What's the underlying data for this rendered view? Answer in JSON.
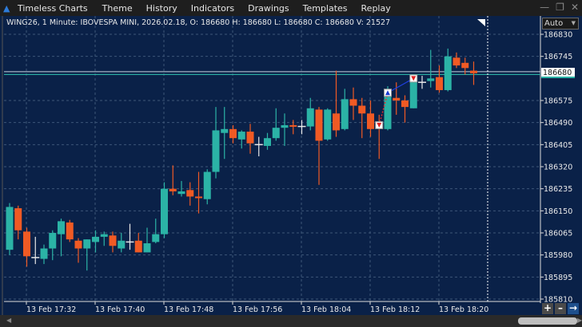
{
  "app": {
    "title": "Timeless Charts",
    "menu": [
      "Theme",
      "History",
      "Indicators",
      "Drawings",
      "Templates",
      "Replay"
    ]
  },
  "window_controls": [
    "minimize",
    "restore",
    "close"
  ],
  "info": "WING26, 1 Minute: IBOVESPA MINI, 2026.02.18, O: 186680 H: 186680 L: 186680 C: 186680 V: 21527",
  "scale_mode": "Auto",
  "current_price": "186680",
  "colors": {
    "up": "#2bb3a6",
    "down": "#f05a24",
    "background": "#0a2148",
    "doji": "#e8e8e8"
  },
  "chart_data": {
    "type": "candlestick",
    "y_ticks": [
      186830,
      186745,
      186575,
      186490,
      186405,
      186320,
      186235,
      186150,
      186065,
      185980,
      185895,
      185810
    ],
    "y_tick_labels": [
      "186830",
      "186745",
      "186575",
      "186490",
      "186405",
      "186320",
      "186235",
      "186150",
      "186065",
      "185980",
      "185895",
      "185810"
    ],
    "ylim": [
      185810,
      186830
    ],
    "x_tick_labels": [
      "13 Feb 17:32",
      "13 Feb 17:40",
      "13 Feb 17:48",
      "13 Feb 17:56",
      "13 Feb 18:04",
      "13 Feb 18:12",
      "13 Feb 18:20"
    ],
    "grid": true,
    "candles": [
      [
        186000,
        186180,
        185980,
        186165
      ],
      [
        186160,
        186170,
        186040,
        186075
      ],
      [
        186070,
        186085,
        185935,
        185975
      ],
      [
        185970,
        186050,
        185945,
        185970
      ],
      [
        185965,
        186020,
        185945,
        186005
      ],
      [
        186005,
        186075,
        185960,
        186065
      ],
      [
        186060,
        186120,
        185975,
        186110
      ],
      [
        186105,
        186115,
        186030,
        186040
      ],
      [
        186035,
        186045,
        185950,
        186005
      ],
      [
        186005,
        186040,
        185920,
        186040
      ],
      [
        186030,
        186075,
        185990,
        186050
      ],
      [
        186050,
        186070,
        186015,
        186060
      ],
      [
        186055,
        186070,
        185990,
        186015
      ],
      [
        186005,
        186065,
        185990,
        186035
      ],
      [
        186030,
        186100,
        186000,
        186030
      ],
      [
        186035,
        186065,
        185990,
        185990
      ],
      [
        185990,
        186085,
        185990,
        186025
      ],
      [
        186030,
        186120,
        186025,
        186060
      ],
      [
        186060,
        186260,
        186045,
        186235
      ],
      [
        186235,
        186325,
        186210,
        186225
      ],
      [
        186215,
        186265,
        186205,
        186225
      ],
      [
        186230,
        186260,
        186170,
        186205
      ],
      [
        186205,
        186300,
        186140,
        186200
      ],
      [
        186195,
        186310,
        186175,
        186300
      ],
      [
        186300,
        186550,
        186275,
        186460
      ],
      [
        186450,
        186550,
        186350,
        186465
      ],
      [
        186465,
        186480,
        186410,
        186430
      ],
      [
        186425,
        186460,
        186390,
        186455
      ],
      [
        186455,
        186485,
        186370,
        186410
      ],
      [
        186405,
        186435,
        186360,
        186405
      ],
      [
        186400,
        186450,
        186385,
        186430
      ],
      [
        186430,
        186545,
        186420,
        186470
      ],
      [
        186470,
        186525,
        186400,
        186480
      ],
      [
        186480,
        186500,
        186445,
        186475
      ],
      [
        186475,
        186500,
        186445,
        186475
      ],
      [
        186475,
        186585,
        186460,
        186545
      ],
      [
        186540,
        186550,
        186250,
        186420
      ],
      [
        186425,
        186545,
        186420,
        186540
      ],
      [
        186525,
        186690,
        186435,
        186460
      ],
      [
        186465,
        186620,
        186460,
        186580
      ],
      [
        186580,
        186625,
        186500,
        186555
      ],
      [
        186555,
        186585,
        186430,
        186525
      ],
      [
        186525,
        186575,
        186435,
        186465
      ],
      [
        186485,
        186520,
        186350,
        186470
      ],
      [
        186465,
        186630,
        186460,
        186620
      ],
      [
        186585,
        186645,
        186520,
        186575
      ],
      [
        186575,
        186595,
        186490,
        186550
      ],
      [
        186545,
        186665,
        186545,
        186660
      ],
      [
        186645,
        186670,
        186620,
        186645
      ],
      [
        186650,
        186770,
        186625,
        186660
      ],
      [
        186665,
        186710,
        186605,
        186615
      ],
      [
        186615,
        186775,
        186610,
        186745
      ],
      [
        186740,
        186760,
        186700,
        186710
      ],
      [
        186720,
        186740,
        186675,
        186700
      ],
      [
        186690,
        186725,
        186635,
        186680
      ]
    ],
    "trade_markers": [
      {
        "candle": 43,
        "type": "sell",
        "price": 186480
      },
      {
        "candle": 44,
        "type": "buy",
        "price": 186605
      },
      {
        "candle": 47,
        "type": "sell",
        "price": 186660
      }
    ]
  }
}
